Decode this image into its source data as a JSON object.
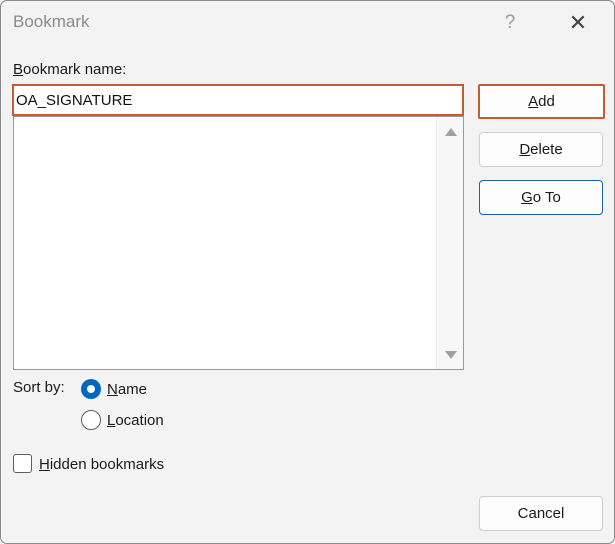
{
  "window": {
    "title": "Bookmark",
    "help_glyph": "?",
    "close_glyph": "✕"
  },
  "name_label": {
    "first": "B",
    "rest": "ookmark name:"
  },
  "name_input": {
    "value": "OA_SIGNATURE"
  },
  "buttons": {
    "add": {
      "first": "A",
      "rest": "dd"
    },
    "delete": {
      "first": "D",
      "rest": "elete"
    },
    "goto": {
      "first": "G",
      "rest": "o To"
    },
    "cancel": "Cancel"
  },
  "sort": {
    "label": "Sort by:",
    "name": {
      "first": "N",
      "rest": "ame",
      "selected": true
    },
    "location": {
      "first": "L",
      "rest": "ocation",
      "selected": false
    }
  },
  "hidden": {
    "first": "H",
    "rest": "idden bookmarks",
    "checked": false
  },
  "colors": {
    "focus_border": "#c65a33",
    "accent": "#0067c0",
    "default_button_border": "#1f5f9a"
  }
}
